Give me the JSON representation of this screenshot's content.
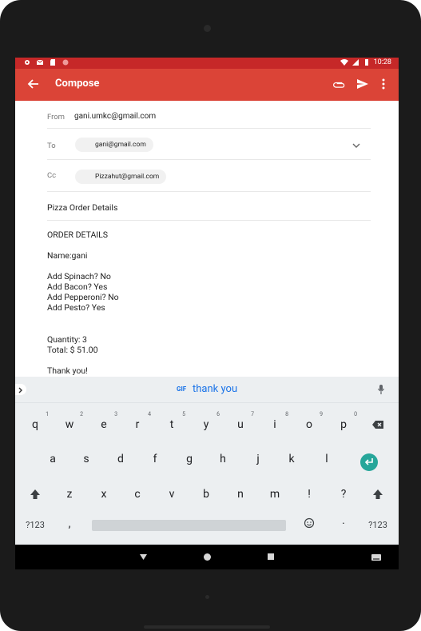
{
  "status_bar": {
    "time": "10:28",
    "icons_left": [
      "settings-icon",
      "gmail-icon",
      "sd-card-icon",
      "record-icon"
    ],
    "icons_right": [
      "wifi-icon",
      "signal-icon",
      "battery-icon"
    ]
  },
  "appbar": {
    "title": "Compose",
    "icons": [
      "back-arrow-icon",
      "attachment-icon",
      "send-icon",
      "more-vert-icon"
    ],
    "color": "#db4437"
  },
  "compose": {
    "from_label": "From",
    "from_value": "gani.umkc@gmail.com",
    "to_label": "To",
    "to_value": "gani@gmail.com",
    "cc_label": "Cc",
    "cc_value": "Pizzahut@gmail.com",
    "subject": "Pizza Order Details",
    "body": {
      "line1": "ORDER DETAILS",
      "line2": "Name:gani",
      "line3": "Add Spinach? No",
      "line4": "Add Bacon? Yes",
      "line5": "Add Pepperoni? No",
      "line6": "Add Pesto? Yes",
      "line7": "Quantity: 3",
      "line8": "Total: $ 51.00",
      "line9": "Thank you!"
    }
  },
  "keyboard": {
    "suggestion_label": "GIF",
    "suggestion": "thank you",
    "row1": [
      "q",
      "w",
      "e",
      "r",
      "t",
      "y",
      "u",
      "i",
      "o",
      "p"
    ],
    "row1_hints": [
      "1",
      "2",
      "3",
      "4",
      "5",
      "6",
      "7",
      "8",
      "9",
      "0"
    ],
    "row2": [
      "a",
      "s",
      "d",
      "f",
      "g",
      "h",
      "j",
      "k",
      "l"
    ],
    "row3": [
      "z",
      "x",
      "c",
      "v",
      "b",
      "n",
      "m",
      "!",
      "?"
    ],
    "symbols_label": "?123",
    "comma": ",",
    "dot": "·",
    "accent": "#26a69a"
  },
  "navbar": {
    "icons": [
      "nav-back-icon",
      "nav-home-icon",
      "nav-recent-icon",
      "keyboard-switch-icon"
    ]
  }
}
